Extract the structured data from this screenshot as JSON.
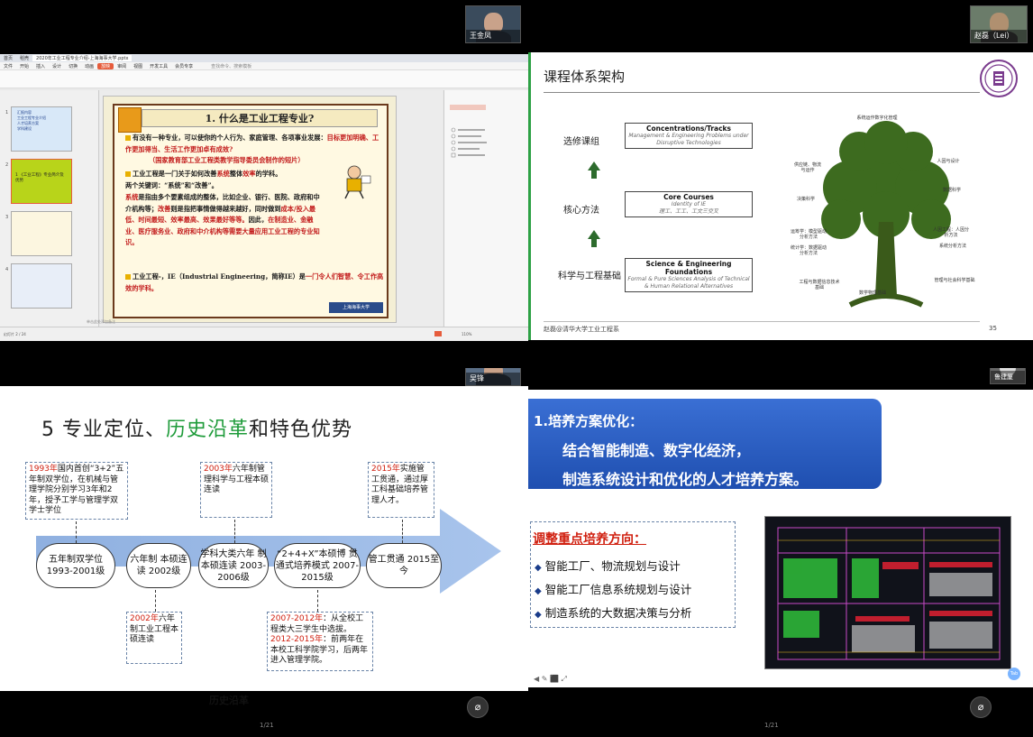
{
  "participants": {
    "tl": "王金凤",
    "tr": "赵磊（Lei）",
    "bl": "吴锋",
    "br": "鲁建厦"
  },
  "page_indicator": {
    "left": "1/21",
    "right": "1/21"
  },
  "wps": {
    "tabs": [
      "首页",
      "稻壳",
      "2020年工业工程专业介绍-上海海事大学.pptx"
    ],
    "menu": [
      "文件",
      "开始",
      "插入",
      "设计",
      "切换",
      "动画",
      "放映",
      "审阅",
      "视图",
      "开发工具",
      "会员专享"
    ],
    "menu_selected": "放映",
    "search_placeholder": "查找命令、搜索模板",
    "status_left": "幻灯片 2 / 24",
    "notes_placeholder": "单击此处添加备注",
    "zoom": "110%",
    "thumb_numbers": [
      "1",
      "2",
      "3",
      "4"
    ],
    "thumb1_lines": [
      "汇报内容",
      "工业工程专业介绍",
      "人才培养方案",
      "学科建设"
    ],
    "thumb2_text": "1 《工业工程》专业简介及优势"
  },
  "slide_ie": {
    "title": "1. 什么是工业工程专业?",
    "p1_a": "有没有一种专业，可以使你的个人行为、家庭管理、各项事业发展：",
    "p1_b": "目标更加明确、工作更加得当、生活工作更加卓有成效?",
    "p1_c": "（国家教育部工业工程类教学指导委员会制作的短片）",
    "p2_a": "工业工程是一门关于如何改善",
    "p2_b": "系统",
    "p2_c": "整体",
    "p2_d": "效率",
    "p2_e": "的学科。",
    "p3": "两个关键词：“系统”和“改善”。",
    "p4_a": "系统",
    "p4_b": "是指由多个要素组成的整体，比如企业、银行、医院、政府和中介机构等；",
    "p4_c": "改善",
    "p4_d": "则是指把事情做得越来越好，同时做到",
    "p4_e": "成本/投入最低、时间最短、效率最高、效果最好等等。",
    "p4_f": "因此，",
    "p4_g": "在制造业、金融业、医疗服务业、政府和中介机构等需要大量应用工业工程的专业知识。",
    "p5_a": "工业工程-，IE（Industrial Engineering，简称IE）是",
    "p5_b": "一门令人们智慧、令工作高效的学科。",
    "logo": "上海海事大学"
  },
  "slide_curriculum": {
    "title": "课程体系架构",
    "level1_label": "选修课组",
    "level2_label": "核心方法",
    "level3_label": "科学与工程基础",
    "box1_title": "Concentrations/Tracks",
    "box1_sub": "Management & Engineering Problems under Disruptive Technologies",
    "box2_title": "Core Courses",
    "box2_sub1": "Identity of IE",
    "box2_sub2": "理工、工工、工文三交叉",
    "box3_title": "Science & Engineering Foundations",
    "box3_sub": "Formal & Pure Sciences Analysis of Technical & Human Relational Alternatives",
    "tree_labels": [
      "系统运作数字化管理",
      "供应链、物流与运作",
      "人因与设计",
      "决策科学",
      "数据科学",
      "运筹学：模型驱动分析方法",
      "统计学：数据驱动分析方法",
      "人因工程：人因分析方法",
      "工程与数据信息技术基础",
      "数学物理基础",
      "管理与社会科学基础",
      "系统分析方法"
    ],
    "footer": "赵磊@清华大学工业工程系",
    "page": "35"
  },
  "slide_history": {
    "title_a": "5 专业定位、",
    "title_b": "历史沿革",
    "title_c": "和特色优势",
    "stages": [
      "五年制双学位 1993-2001级",
      "六年制 本硕连读 2002级",
      "学科大类六年 制本硕连读 2003-2006级",
      "“2+4+X”本硕博 贯通式培养模式 2007-2015级",
      "管工贯通 2015至今"
    ],
    "note1_year": "1993年",
    "note1_text": "国内首创“3+2”五年制双学位，在机械与管理学院分别学习3年和2年，授予工学与管理学双学士学位",
    "note2_year": "2003年",
    "note2_text": "六年制管理科学与工程本硕连读",
    "note3_year": "2015年",
    "note3_text": "实施管工贯通，通过厚工科基础培养管理人才。",
    "note4_year": "2002年",
    "note4_text": "六年制工业工程本硕连读",
    "note5_year_a": "2007-2012年",
    "note5_text_a": "：从全校工程类大三学生中选拔。",
    "note5_year_b": "2012-2015年",
    "note5_text_b": "：前两年在本校工科学院学习，后两年进入管理学院。",
    "caption": "历史沿革"
  },
  "slide_training": {
    "line1": "1.培养方案优化：",
    "line2": "结合智能制造、数字化经济，",
    "line3": "制造系统设计和优化的人才培养方案。",
    "dir_title": "调整重点培养方向：",
    "dirs": [
      "智能工厂、物流规划与设计",
      "智能工厂信息系统规划与设计",
      "制造系统的大数据决策与分析"
    ],
    "badge": "Tab"
  }
}
